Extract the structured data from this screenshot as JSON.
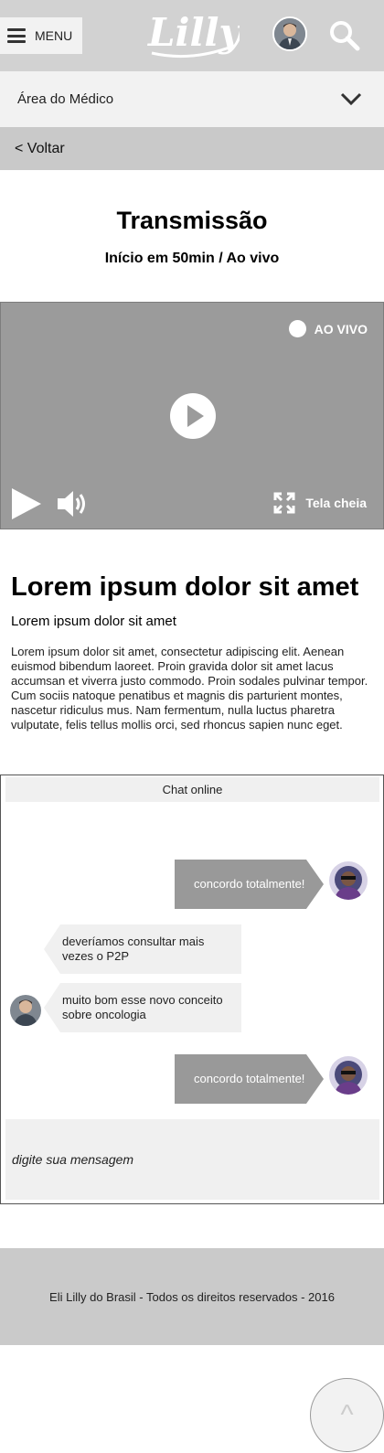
{
  "header": {
    "menu_label": "MENU",
    "logo_text": "Lilly"
  },
  "nav": {
    "area_label": "Área do Médico",
    "back_label": "< Voltar"
  },
  "page": {
    "title": "Transmissão",
    "subtitle": "Início em 50min / Ao vivo"
  },
  "video": {
    "live_label": "AO VIVO",
    "fullscreen_label": "Tela cheia"
  },
  "article": {
    "title": "Lorem ipsum dolor sit amet",
    "subtitle": "Lorem ipsum dolor sit amet",
    "body": "Lorem ipsum dolor sit amet, consectetur adipiscing elit. Aenean euismod bibendum laoreet. Proin gravida dolor sit amet lacus accumsan et viverra justo commodo. Proin sodales pulvinar tempor. Cum sociis natoque penatibus et magnis dis parturient montes, nascetur ridiculus mus. Nam fermentum, nulla luctus pharetra vulputate, felis tellus mollis orci, sed rhoncus sapien nunc eget."
  },
  "chat": {
    "title": "Chat online",
    "messages": [
      {
        "side": "right",
        "text": "concordo totalmente!"
      },
      {
        "side": "left",
        "text": "deveríamos consultar mais vezes o P2P"
      },
      {
        "side": "left",
        "text": "muito bom esse novo conceito sobre oncologia"
      },
      {
        "side": "right",
        "text": "concordo totalmente!"
      }
    ],
    "input_placeholder": "digite sua mensagem"
  },
  "footer": {
    "text": "Eli Lilly do Brasil - Todos os direitos reservados - 2016"
  },
  "back_to_top": {
    "label": "^"
  },
  "colors": {
    "header_bg": "#d2d2d2",
    "video_bg": "#9b9b9b",
    "bubble_right": "#999999",
    "bubble_left": "#f0f0f0",
    "footer_bg": "#cacaca"
  }
}
